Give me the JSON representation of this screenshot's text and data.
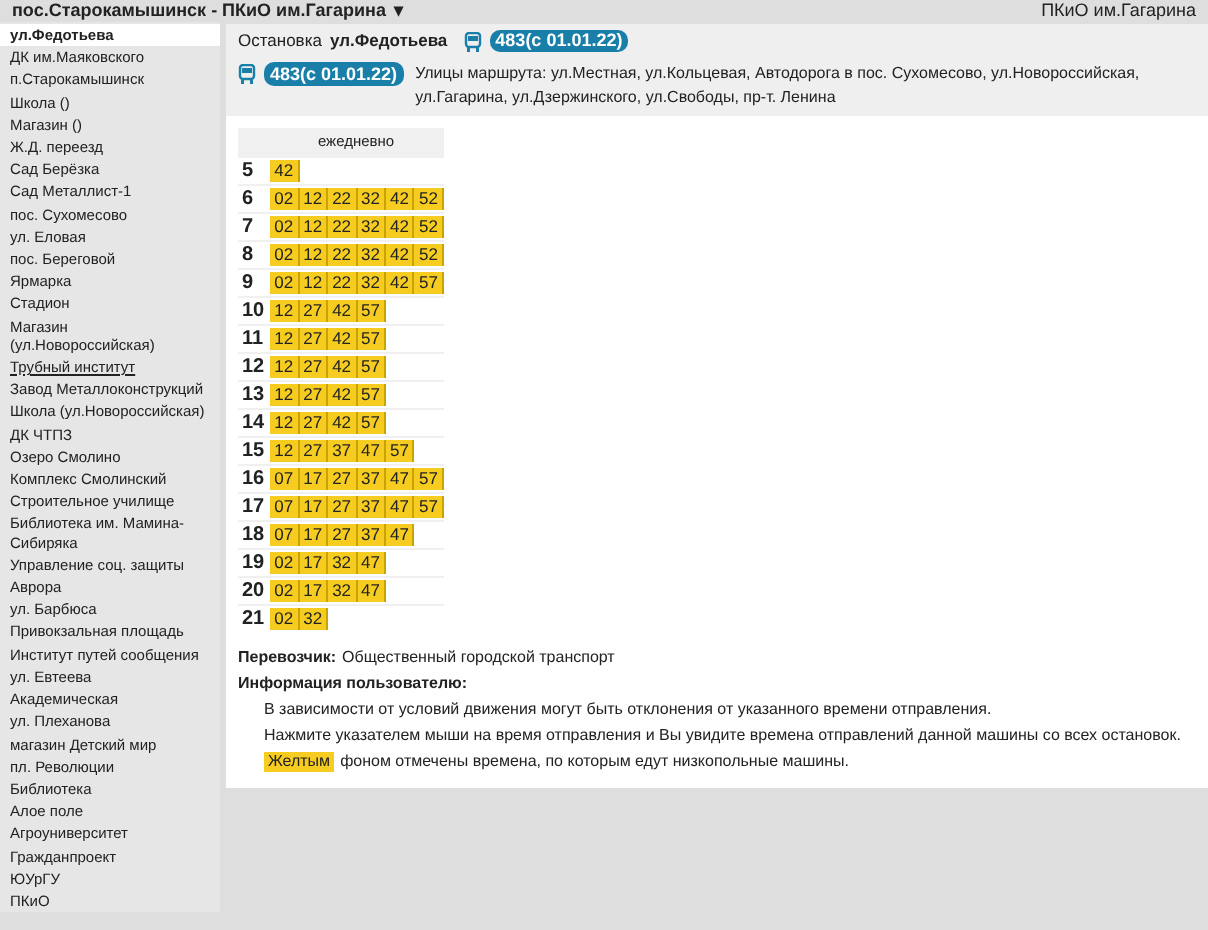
{
  "top_bar": {
    "route_title": "пос.Старокамышинск - ПКиО им.Гагарина",
    "dropdown_caret": "▾",
    "right_text": "ПКиО им.Гагарина"
  },
  "sidebar": {
    "items": [
      {
        "label": "ул.Федотьева",
        "selected": true,
        "hovered": false
      },
      {
        "label": "ДК им.Маяковского",
        "selected": false,
        "hovered": false
      },
      {
        "label": "п.Старокамышинск",
        "selected": false,
        "hovered": false
      },
      {
        "label": "Школа ()",
        "selected": false,
        "hovered": false
      },
      {
        "label": "Магазин ()",
        "selected": false,
        "hovered": false
      },
      {
        "label": "Ж.Д. переезд",
        "selected": false,
        "hovered": false
      },
      {
        "label": "Сад Берёзка",
        "selected": false,
        "hovered": false
      },
      {
        "label": "Сад Металлист-1",
        "selected": false,
        "hovered": false
      },
      {
        "label": "пос. Сухомесово",
        "selected": false,
        "hovered": false
      },
      {
        "label": "ул. Еловая",
        "selected": false,
        "hovered": false
      },
      {
        "label": "пос. Береговой",
        "selected": false,
        "hovered": false
      },
      {
        "label": "Ярмарка",
        "selected": false,
        "hovered": false
      },
      {
        "label": "Стадион",
        "selected": false,
        "hovered": false
      },
      {
        "label": "Магазин (ул.Новороссийская)",
        "selected": false,
        "hovered": false
      },
      {
        "label": "Трубный институт",
        "selected": false,
        "hovered": true
      },
      {
        "label": "Завод Металлоконструкций",
        "selected": false,
        "hovered": false
      },
      {
        "label": "Школа (ул.Новороссийская)",
        "selected": false,
        "hovered": false
      },
      {
        "label": "ДК ЧТПЗ",
        "selected": false,
        "hovered": false
      },
      {
        "label": "Озеро Смолино",
        "selected": false,
        "hovered": false
      },
      {
        "label": "Комплекс Смолинский",
        "selected": false,
        "hovered": false
      },
      {
        "label": "Строительное училище",
        "selected": false,
        "hovered": false
      },
      {
        "label": "Библиотека им. Мамина-Сибиряка",
        "selected": false,
        "hovered": false
      },
      {
        "label": "Управление соц. защиты",
        "selected": false,
        "hovered": false
      },
      {
        "label": "Аврора",
        "selected": false,
        "hovered": false
      },
      {
        "label": "ул. Барбюса",
        "selected": false,
        "hovered": false
      },
      {
        "label": "Привокзальная площадь",
        "selected": false,
        "hovered": false
      },
      {
        "label": "Институт путей сообщения",
        "selected": false,
        "hovered": false
      },
      {
        "label": "ул. Евтеева",
        "selected": false,
        "hovered": false
      },
      {
        "label": "Академическая",
        "selected": false,
        "hovered": false
      },
      {
        "label": "ул. Плеханова",
        "selected": false,
        "hovered": false
      },
      {
        "label": "магазин Детский мир",
        "selected": false,
        "hovered": false
      },
      {
        "label": "пл. Революции",
        "selected": false,
        "hovered": false
      },
      {
        "label": "Библиотека",
        "selected": false,
        "hovered": false
      },
      {
        "label": "Алое поле",
        "selected": false,
        "hovered": false
      },
      {
        "label": "Агроуниверситет",
        "selected": false,
        "hovered": false
      },
      {
        "label": "Гражданпроект",
        "selected": false,
        "hovered": false
      },
      {
        "label": "ЮУрГУ",
        "selected": false,
        "hovered": false
      },
      {
        "label": "ПКиО",
        "selected": false,
        "hovered": false
      }
    ]
  },
  "stop_info": {
    "stop_prefix": "Остановка",
    "stop_name": "ул.Федотьева",
    "route_badge": "483(с 01.01.22)",
    "route_badge_2": "483(с 01.01.22)",
    "streets": "Улицы маршрута: ул.Местная, ул.Кольцевая, Автодорога в пос. Сухомесово, ул.Новороссийская, ул.Гагарина, ул.Дзержинского, ул.Свободы, пр-т. Ленина"
  },
  "timetable": {
    "column_heading": "ежедневно",
    "rows": [
      {
        "hour": "5",
        "minutes": [
          "42"
        ],
        "low_floor": true
      },
      {
        "hour": "6",
        "minutes": [
          "02",
          "12",
          "22",
          "32",
          "42",
          "52"
        ],
        "low_floor": true
      },
      {
        "hour": "7",
        "minutes": [
          "02",
          "12",
          "22",
          "32",
          "42",
          "52"
        ],
        "low_floor": true
      },
      {
        "hour": "8",
        "minutes": [
          "02",
          "12",
          "22",
          "32",
          "42",
          "52"
        ],
        "low_floor": true
      },
      {
        "hour": "9",
        "minutes": [
          "02",
          "12",
          "22",
          "32",
          "42",
          "57"
        ],
        "low_floor": true
      },
      {
        "hour": "10",
        "minutes": [
          "12",
          "27",
          "42",
          "57"
        ],
        "low_floor": true
      },
      {
        "hour": "11",
        "minutes": [
          "12",
          "27",
          "42",
          "57"
        ],
        "low_floor": true
      },
      {
        "hour": "12",
        "minutes": [
          "12",
          "27",
          "42",
          "57"
        ],
        "low_floor": true
      },
      {
        "hour": "13",
        "minutes": [
          "12",
          "27",
          "42",
          "57"
        ],
        "low_floor": true
      },
      {
        "hour": "14",
        "minutes": [
          "12",
          "27",
          "42",
          "57"
        ],
        "low_floor": true
      },
      {
        "hour": "15",
        "minutes": [
          "12",
          "27",
          "37",
          "47",
          "57"
        ],
        "low_floor": true
      },
      {
        "hour": "16",
        "minutes": [
          "07",
          "17",
          "27",
          "37",
          "47",
          "57"
        ],
        "low_floor": true
      },
      {
        "hour": "17",
        "minutes": [
          "07",
          "17",
          "27",
          "37",
          "47",
          "57"
        ],
        "low_floor": true
      },
      {
        "hour": "18",
        "minutes": [
          "07",
          "17",
          "27",
          "37",
          "47"
        ],
        "low_floor": true
      },
      {
        "hour": "19",
        "minutes": [
          "02",
          "17",
          "32",
          "47"
        ],
        "low_floor": true
      },
      {
        "hour": "20",
        "minutes": [
          "02",
          "17",
          "32",
          "47"
        ],
        "low_floor": true
      },
      {
        "hour": "21",
        "minutes": [
          "02",
          "32"
        ],
        "low_floor": true
      }
    ]
  },
  "carrier": {
    "label": "Перевозчик:",
    "value": "Общественный городской транспорт"
  },
  "user_info": {
    "heading": "Информация пользователю:",
    "lines": [
      "В зависимости от условий движения могут быть отклонения от указанного времени отправления.",
      "Нажмите указателем мыши на время отправления и Вы увидите времена отправлений данной машины со всех остановок."
    ],
    "legend_word": "Желтым",
    "legend_text": "фоном отмечены времена, по которым едут низкопольные машины."
  }
}
